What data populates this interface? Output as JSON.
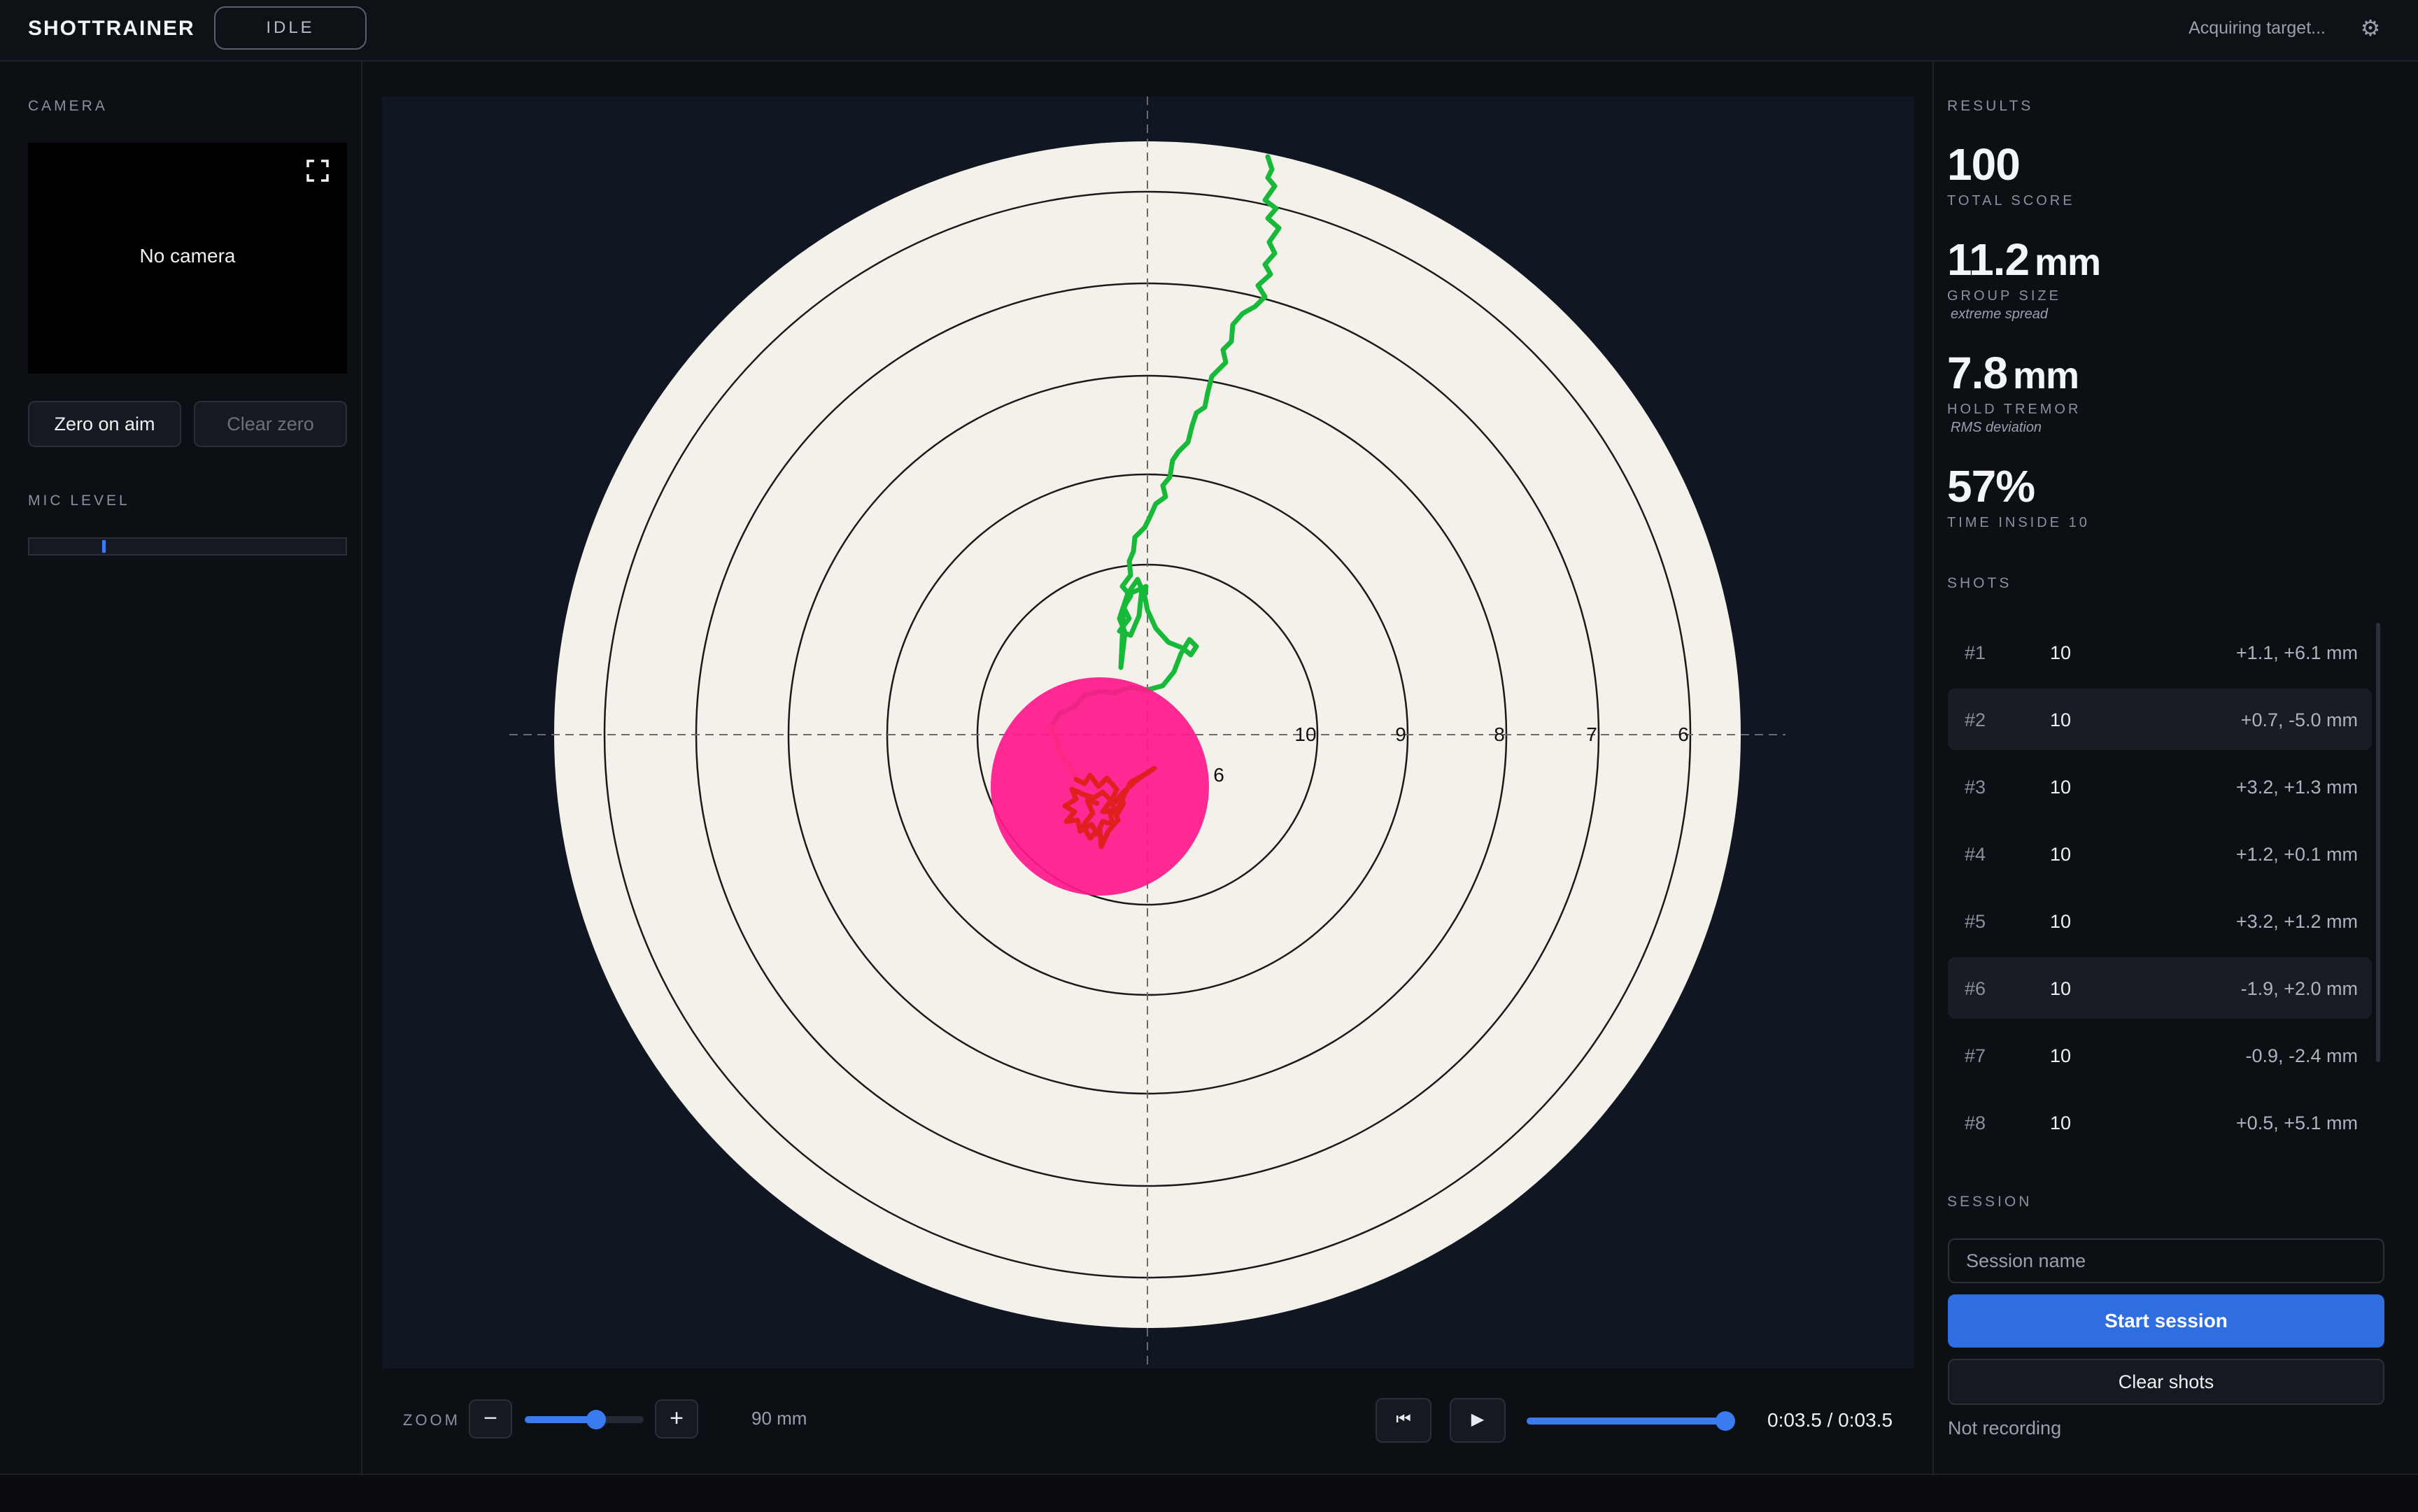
{
  "app": {
    "title": "SHOTTRAINER",
    "state": "IDLE",
    "status": "Acquiring target...",
    "settings_icon": "gear-icon"
  },
  "camera": {
    "section": "CAMERA",
    "message": "No camera",
    "expand_icon": "expand-icon",
    "zero_button": "Zero on aim",
    "clear_zero_button": "Clear zero"
  },
  "mic": {
    "section": "MIC LEVEL",
    "level": 0.23
  },
  "target": {
    "ring_labels": [
      "10",
      "9",
      "8",
      "7",
      "6"
    ],
    "inner_label": "6",
    "colors": {
      "face": "#f4f1ea",
      "background": "#111722",
      "trace": "#18b838",
      "pre_shot": "#f0d020",
      "hold": "#e02020",
      "impact": "#ff1a8c"
    }
  },
  "zoom": {
    "label": "ZOOM",
    "minus": "−",
    "plus": "+",
    "level": 0.6,
    "value": "90 mm"
  },
  "playback": {
    "rewind": "⏮",
    "play": "▶",
    "progress": 1.0,
    "time": "0:03.5 / 0:03.5"
  },
  "results": {
    "section": "RESULTS",
    "total_score": {
      "value": "100",
      "label": "TOTAL SCORE"
    },
    "group_size": {
      "value": "11.2",
      "unit": "mm",
      "label": "GROUP SIZE",
      "note": "extreme spread"
    },
    "hold_tremor": {
      "value": "7.8",
      "unit": "mm",
      "label": "HOLD TREMOR",
      "note": "RMS deviation"
    },
    "time_inside": {
      "value": "57%",
      "label": "TIME INSIDE 10"
    }
  },
  "shots": {
    "section": "SHOTS",
    "items": [
      {
        "num": "#1",
        "score": "10",
        "offset": "+1.1,  +6.1 mm"
      },
      {
        "num": "#2",
        "score": "10",
        "offset": "+0.7,  -5.0 mm"
      },
      {
        "num": "#3",
        "score": "10",
        "offset": "+3.2,  +1.3 mm"
      },
      {
        "num": "#4",
        "score": "10",
        "offset": "+1.2,  +0.1 mm"
      },
      {
        "num": "#5",
        "score": "10",
        "offset": "+3.2,  +1.2 mm"
      },
      {
        "num": "#6",
        "score": "10",
        "offset": "-1.9,  +2.0 mm"
      },
      {
        "num": "#7",
        "score": "10",
        "offset": "-0.9,  -2.4 mm"
      },
      {
        "num": "#8",
        "score": "10",
        "offset": "+0.5,  +5.1 mm"
      }
    ]
  },
  "session": {
    "section": "SESSION",
    "name_placeholder": "Session name",
    "start_button": "Start session",
    "clear_button": "Clear shots",
    "recording_status": "Not recording"
  }
}
